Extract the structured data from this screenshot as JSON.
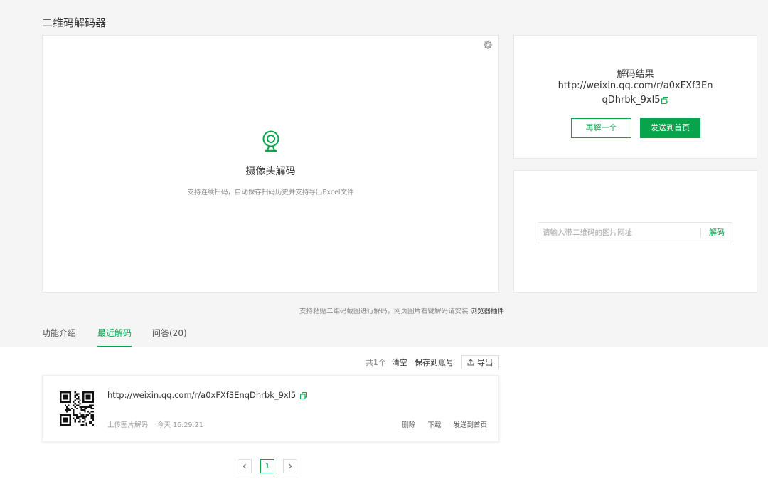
{
  "page": {
    "title": "二维码解码器"
  },
  "camera": {
    "title": "摄像头解码",
    "desc": "支持连续扫码，自动保存扫码历史并支持导出Excel文件"
  },
  "result": {
    "label": "解码结果",
    "url": "http://weixin.qq.com/r/a0xFXf3EnqDhrbk_9xl5",
    "retry_label": "再解一个",
    "send_label": "发送到首页"
  },
  "url_decode": {
    "placeholder": "请输入带二维码的图片网址",
    "button_label": "解码"
  },
  "paste_tip": {
    "text": "支持粘贴二维码截图进行解码，网页图片右键解码请安装",
    "link": "浏览器插件"
  },
  "tabs": [
    {
      "label": "功能介绍"
    },
    {
      "label": "最近解码"
    },
    {
      "label": "问答(20)"
    }
  ],
  "toolbar": {
    "count": "共1个",
    "clear": "清空",
    "save": "保存到账号",
    "export": "导出"
  },
  "records": [
    {
      "url": "http://weixin.qq.com/r/a0xFXf3EnqDhrbk_9xl5",
      "source": "上传图片解码",
      "time": "今天 16:29:21",
      "actions": {
        "delete": "删除",
        "download": "下载",
        "send": "发送到首页"
      }
    }
  ],
  "pager": {
    "current": "1"
  },
  "colors": {
    "accent": "#07a44c"
  }
}
